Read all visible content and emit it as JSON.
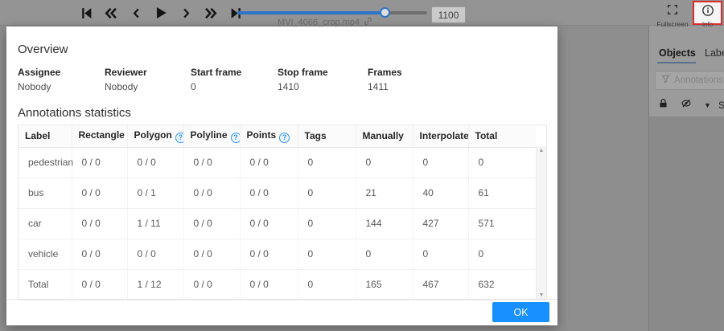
{
  "player": {
    "controls": [
      "first-frame",
      "rewind",
      "previous-frame",
      "play",
      "next-frame",
      "fast-forward",
      "last-frame"
    ],
    "filename": "MVI_4066_crop.mp4",
    "frame_value": "1100",
    "slider_percent": 78
  },
  "topbar": {
    "fullscreen_label": "Fullscreen",
    "info_label": "Info"
  },
  "sidebar": {
    "tabs": [
      "Objects",
      "Labels"
    ],
    "filter_placeholder": "Annotations filter",
    "sort_label": "So",
    "icons": [
      "lock-icon",
      "hide-eye-icon",
      "caret-down-icon"
    ]
  },
  "modal": {
    "overview": {
      "title": "Overview",
      "fields": [
        {
          "label": "Assignee",
          "value": "Nobody"
        },
        {
          "label": "Reviewer",
          "value": "Nobody"
        },
        {
          "label": "Start frame",
          "value": "0"
        },
        {
          "label": "Stop frame",
          "value": "1410"
        },
        {
          "label": "Frames",
          "value": "1411"
        }
      ]
    },
    "statistics": {
      "title": "Annotations statistics",
      "columns": [
        "Label",
        "Rectangle",
        "Polygon",
        "Polyline",
        "Points",
        "Tags",
        "Manually",
        "Interpolated",
        "Total"
      ],
      "rows": [
        [
          "pedestrian",
          "0 / 0",
          "0 / 0",
          "0 / 0",
          "0 / 0",
          "0",
          "0",
          "0",
          "0"
        ],
        [
          "bus",
          "0 / 0",
          "0 / 1",
          "0 / 0",
          "0 / 0",
          "0",
          "21",
          "40",
          "61"
        ],
        [
          "car",
          "0 / 0",
          "1 / 11",
          "0 / 0",
          "0 / 0",
          "0",
          "144",
          "427",
          "571"
        ],
        [
          "vehicle",
          "0 / 0",
          "0 / 0",
          "0 / 0",
          "0 / 0",
          "0",
          "0",
          "0",
          "0"
        ],
        [
          "Total",
          "0 / 0",
          "1 / 12",
          "0 / 0",
          "0 / 0",
          "0",
          "165",
          "467",
          "632"
        ]
      ]
    },
    "ok_label": "OK"
  },
  "icons": {
    "help_glyph": "?",
    "caret_down": "▼",
    "scroll_up": "▲",
    "scroll_down": "▼"
  },
  "colors": {
    "accent": "#1890ff",
    "slider_blue": "#2e74c9",
    "info_highlight_red": "#dd2c2c",
    "help_icon_blue": "#2f96ee"
  }
}
